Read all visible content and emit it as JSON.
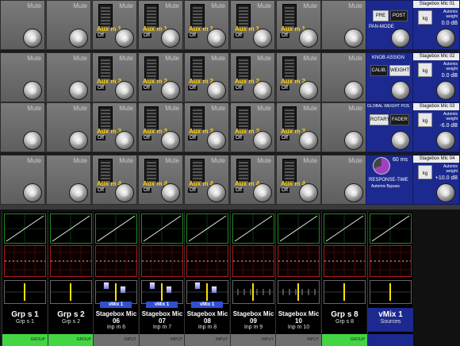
{
  "mute_label": "Mute",
  "off_label": "Off",
  "aux_labels": [
    "Aux m 1",
    "Aux m 2",
    "Aux m 3",
    "Aux m 4"
  ],
  "rows": [
    {
      "aux_columns": [
        2,
        3,
        4,
        5,
        6
      ]
    },
    {
      "aux_columns": [
        2,
        3,
        4,
        5,
        6
      ]
    },
    {
      "aux_columns": [
        2,
        3,
        4,
        5,
        6
      ]
    },
    {
      "aux_columns": [
        2,
        3,
        4,
        5,
        6
      ]
    }
  ],
  "control_panels": {
    "pan_mode": {
      "btn1": "PRE",
      "btn2": "POST",
      "caption": "PAN-MODE"
    },
    "knob_assign": {
      "caption": "KNOB ASSIGN",
      "btn1": "CALIB.",
      "btn2": "WEIGHT"
    },
    "global_weight": {
      "caption": "GLOBAL WEIGHT POS",
      "btn1": "ROTARY",
      "btn2": "FADER"
    },
    "response_time": {
      "value": "60 ms",
      "caption": "RESPONSE-TIME",
      "bypass": "Automix Bypass"
    }
  },
  "mics": [
    {
      "title": "Stagebox Mic 01",
      "unit": "kg",
      "weight_label": "Automix weight",
      "value": "0.0 dB"
    },
    {
      "title": "Stagebox Mic 02",
      "unit": "kg",
      "weight_label": "Automix weight",
      "value": "0.0 dB"
    },
    {
      "title": "Stagebox Mic 03",
      "unit": "kg",
      "weight_label": "Automix weight",
      "value": "-6.0 dB"
    },
    {
      "title": "Stagebox Mic 04",
      "unit": "kg",
      "weight_label": "Automix weight",
      "value": "+10.0 dB"
    }
  ],
  "strips": [
    {
      "name": "Grp s 1",
      "sub": "Grp s 1",
      "foot": "GROUP",
      "type": "group"
    },
    {
      "name": "Grp s 2",
      "sub": "Grp s 2",
      "foot": "GROUP",
      "type": "group"
    },
    {
      "name": "Stagebox Mic 06",
      "sub": "Inp m 6",
      "foot": "INPUT",
      "type": "input",
      "badge": "vMix 1"
    },
    {
      "name": "Stagebox Mic 07",
      "sub": "Inp m 7",
      "foot": "INPUT",
      "type": "input",
      "badge": "vMix 1"
    },
    {
      "name": "Stagebox Mic 08",
      "sub": "Inp m 8",
      "foot": "INPUT",
      "type": "input",
      "badge": "vMix 1"
    },
    {
      "name": "Stagebox Mic 09",
      "sub": "Inp m 9",
      "foot": "INPUT",
      "type": "input"
    },
    {
      "name": "Stagebox Mic 10",
      "sub": "Inp m 10",
      "foot": "INPUT",
      "type": "input"
    },
    {
      "name": "Grp s 8",
      "sub": "Grp s 8",
      "foot": "GROUP",
      "type": "group"
    },
    {
      "name": "vMix 1",
      "sub": "Sources",
      "foot": "",
      "type": "blue"
    }
  ]
}
